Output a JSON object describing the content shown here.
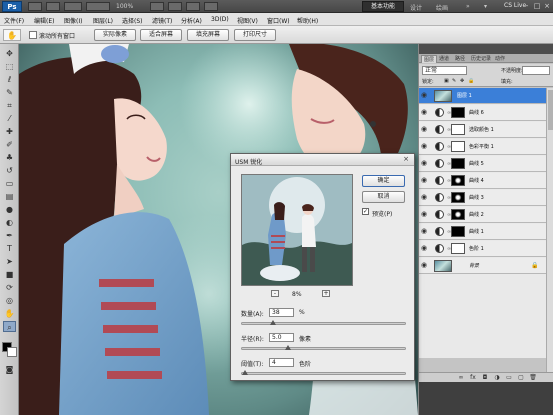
{
  "appbar": {
    "logo": "Ps",
    "zoom": "100%",
    "workspace": "基本功能",
    "links": [
      "设计",
      "绘画"
    ],
    "cs_live": "CS Live",
    "win_controls": [
      "-",
      "□",
      "×"
    ]
  },
  "menu": [
    "文件(F)",
    "编辑(E)",
    "图像(I)",
    "图层(L)",
    "选择(S)",
    "滤镜(T)",
    "分析(A)",
    "3D(D)",
    "视图(V)",
    "窗口(W)",
    "帮助(H)"
  ],
  "options": {
    "checkbox_label": "滚动所有窗口",
    "buttons": [
      "实际像素",
      "适合屏幕",
      "填充屏幕",
      "打印尺寸"
    ]
  },
  "panels": {
    "tabs": [
      "图层",
      "通道",
      "路径",
      "历史记录",
      "动作"
    ],
    "blend_mode": "正常",
    "opacity_label": "不透明度:",
    "lock_label": "锁定:",
    "fill_label": "填充:",
    "layers": [
      {
        "name": "图层 1",
        "kind": "pixel",
        "selected": true
      },
      {
        "name": "曲线 6",
        "kind": "curves",
        "mask": "black"
      },
      {
        "name": "选取颜色 1",
        "kind": "selective",
        "mask": "white"
      },
      {
        "name": "色彩平衡 1",
        "kind": "balance",
        "mask": "white"
      },
      {
        "name": "曲线 5",
        "kind": "curves",
        "mask": "black"
      },
      {
        "name": "曲线 4",
        "kind": "curves",
        "mask": "dark"
      },
      {
        "name": "曲线 3",
        "kind": "curves",
        "mask": "dark"
      },
      {
        "name": "曲线 2",
        "kind": "curves",
        "mask": "dark"
      },
      {
        "name": "曲线 1",
        "kind": "curves",
        "mask": "black"
      },
      {
        "name": "色阶 1",
        "kind": "levels",
        "mask": "white"
      },
      {
        "name": "背景",
        "kind": "background",
        "locked": true
      }
    ]
  },
  "dialog": {
    "title": "USM 锐化",
    "ok": "确定",
    "cancel": "取消",
    "preview_label": "预览(P)",
    "preview_checked": true,
    "zoom_percent": "8%",
    "zoom_minus": "-",
    "zoom_plus": "+",
    "amount": {
      "label": "数量(A):",
      "value": "38",
      "unit": "%",
      "slider_fraction": 0.19
    },
    "radius": {
      "label": "半径(R):",
      "value": "5.0",
      "unit": "像素",
      "slider_fraction": 0.28
    },
    "threshold": {
      "label": "阈值(T):",
      "value": "4",
      "unit": "色阶",
      "slider_fraction": 0.02
    }
  }
}
